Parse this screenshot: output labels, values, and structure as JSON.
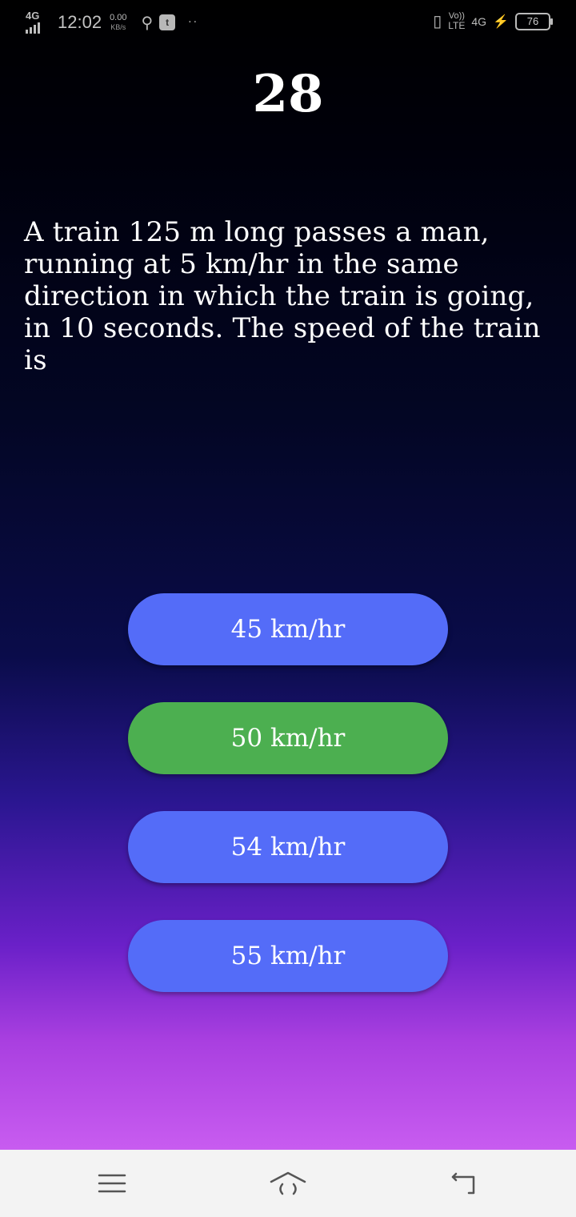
{
  "status_bar": {
    "network_type": "4G",
    "time": "12:02",
    "net_speed_value": "0.00",
    "net_speed_unit": "KB/s",
    "volte_top": "Vo))",
    "volte_bottom": "LTE",
    "mobile_data": "4G",
    "battery_level": "76"
  },
  "question": {
    "number": "28",
    "text": "A train 125 m long passes a man, running at 5 km/hr in the same direction in which the train is going, in 10 seconds. The speed of the train is"
  },
  "options": [
    {
      "label": "45 km/hr",
      "state": "default"
    },
    {
      "label": "50 km/hr",
      "state": "correct"
    },
    {
      "label": "54 km/hr",
      "state": "default"
    },
    {
      "label": "55 km/hr",
      "state": "default"
    }
  ],
  "colors": {
    "option_default": "#546cf8",
    "option_correct": "#4caf50",
    "nav_bar": "#f3f3f3"
  },
  "nav_bar": {
    "icons": [
      "menu-icon",
      "home-icon",
      "back-icon"
    ]
  }
}
